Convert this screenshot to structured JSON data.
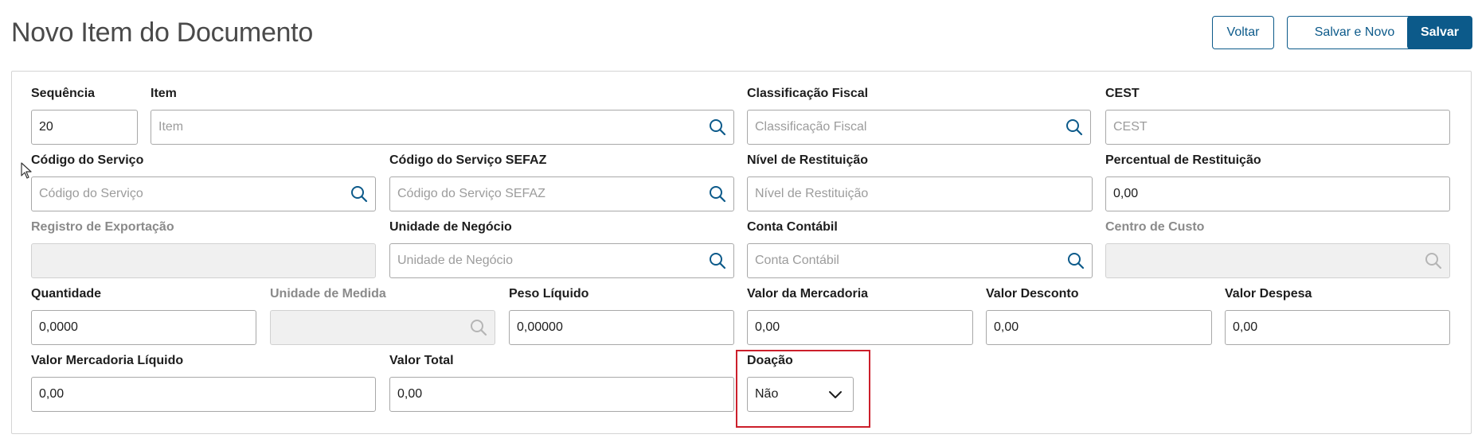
{
  "header": {
    "title": "Novo Item do Documento",
    "buttons": {
      "back": "Voltar",
      "save_new": "Salvar e Novo",
      "save": "Salvar"
    }
  },
  "colors": {
    "accent": "#0c5a8a",
    "highlight": "#cc1f2b"
  },
  "form": {
    "sequencia": {
      "label": "Sequência",
      "value": "20"
    },
    "item": {
      "label": "Item",
      "placeholder": "Item",
      "icon": "search-icon"
    },
    "classificacao_fiscal": {
      "label": "Classificação Fiscal",
      "placeholder": "Classificação Fiscal",
      "icon": "search-icon"
    },
    "cest": {
      "label": "CEST",
      "placeholder": "CEST"
    },
    "codigo_servico": {
      "label": "Código do Serviço",
      "placeholder": "Código do Serviço",
      "icon": "search-icon"
    },
    "codigo_servico_sefaz": {
      "label": "Código do Serviço SEFAZ",
      "placeholder": "Código do Serviço SEFAZ",
      "icon": "search-icon"
    },
    "nivel_restituicao": {
      "label": "Nível de Restituição",
      "placeholder": "Nível de Restituição"
    },
    "percentual_restituicao": {
      "label": "Percentual de Restituição",
      "value": "0,00"
    },
    "registro_exportacao": {
      "label": "Registro de Exportação",
      "value": ""
    },
    "unidade_negocio": {
      "label": "Unidade de Negócio",
      "placeholder": "Unidade de Negócio",
      "icon": "search-icon"
    },
    "conta_contabil": {
      "label": "Conta Contábil",
      "placeholder": "Conta Contábil",
      "icon": "search-icon"
    },
    "centro_custo": {
      "label": "Centro de Custo",
      "value": "",
      "icon": "search-icon"
    },
    "quantidade": {
      "label": "Quantidade",
      "value": "0,0000"
    },
    "unidade_medida": {
      "label": "Unidade de Medida",
      "value": "",
      "icon": "search-icon"
    },
    "peso_liquido": {
      "label": "Peso Líquido",
      "value": "0,00000"
    },
    "valor_mercadoria": {
      "label": "Valor da Mercadoria",
      "value": "0,00"
    },
    "valor_desconto": {
      "label": "Valor Desconto",
      "value": "0,00"
    },
    "valor_despesa": {
      "label": "Valor Despesa",
      "value": "0,00"
    },
    "valor_mercadoria_liquido": {
      "label": "Valor Mercadoria Líquido",
      "value": "0,00"
    },
    "valor_total": {
      "label": "Valor Total",
      "value": "0,00"
    },
    "doacao": {
      "label": "Doação",
      "value": "Não",
      "icon": "chevron-down-icon"
    }
  }
}
